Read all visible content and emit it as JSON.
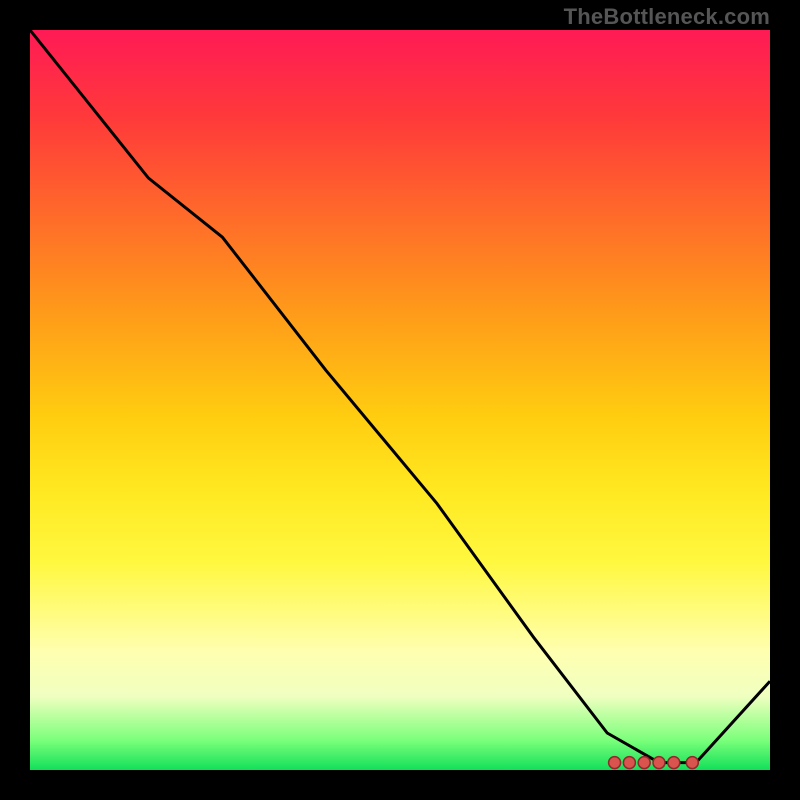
{
  "watermark": "TheBottleneck.com",
  "chart_data": {
    "type": "line",
    "title": "",
    "xlabel": "",
    "ylabel": "",
    "ylim": [
      0,
      100
    ],
    "x": [
      0.0,
      0.08,
      0.16,
      0.26,
      0.4,
      0.55,
      0.68,
      0.78,
      0.85,
      0.9,
      1.0
    ],
    "values": [
      100,
      90,
      80,
      72,
      54,
      36,
      18,
      5,
      1,
      1,
      12
    ],
    "markers_x_fraction": [
      0.79,
      0.81,
      0.83,
      0.85,
      0.87,
      0.895
    ],
    "colors": {
      "line": "#000000",
      "marker_fill": "#d9534f",
      "marker_stroke": "#8b2c2a"
    }
  }
}
